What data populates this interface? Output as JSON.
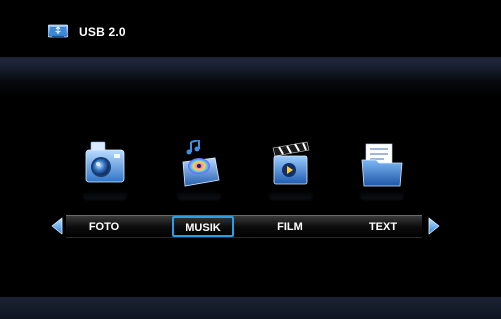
{
  "header": {
    "title": "USB 2.0",
    "icon": "usb-drive-icon"
  },
  "menu": {
    "items": [
      {
        "label": "FOTO",
        "icon": "camera-icon"
      },
      {
        "label": "MUSIK",
        "icon": "music-speaker-icon"
      },
      {
        "label": "FILM",
        "icon": "clapperboard-icon"
      },
      {
        "label": "TEXT",
        "icon": "folder-document-icon"
      }
    ],
    "selected": "MUSIK",
    "prev_arrow": "left-arrow-icon",
    "next_arrow": "right-arrow-icon"
  },
  "colors": {
    "background": "#000000",
    "accent": "#2a9de8",
    "header_band": "#1a2233"
  }
}
